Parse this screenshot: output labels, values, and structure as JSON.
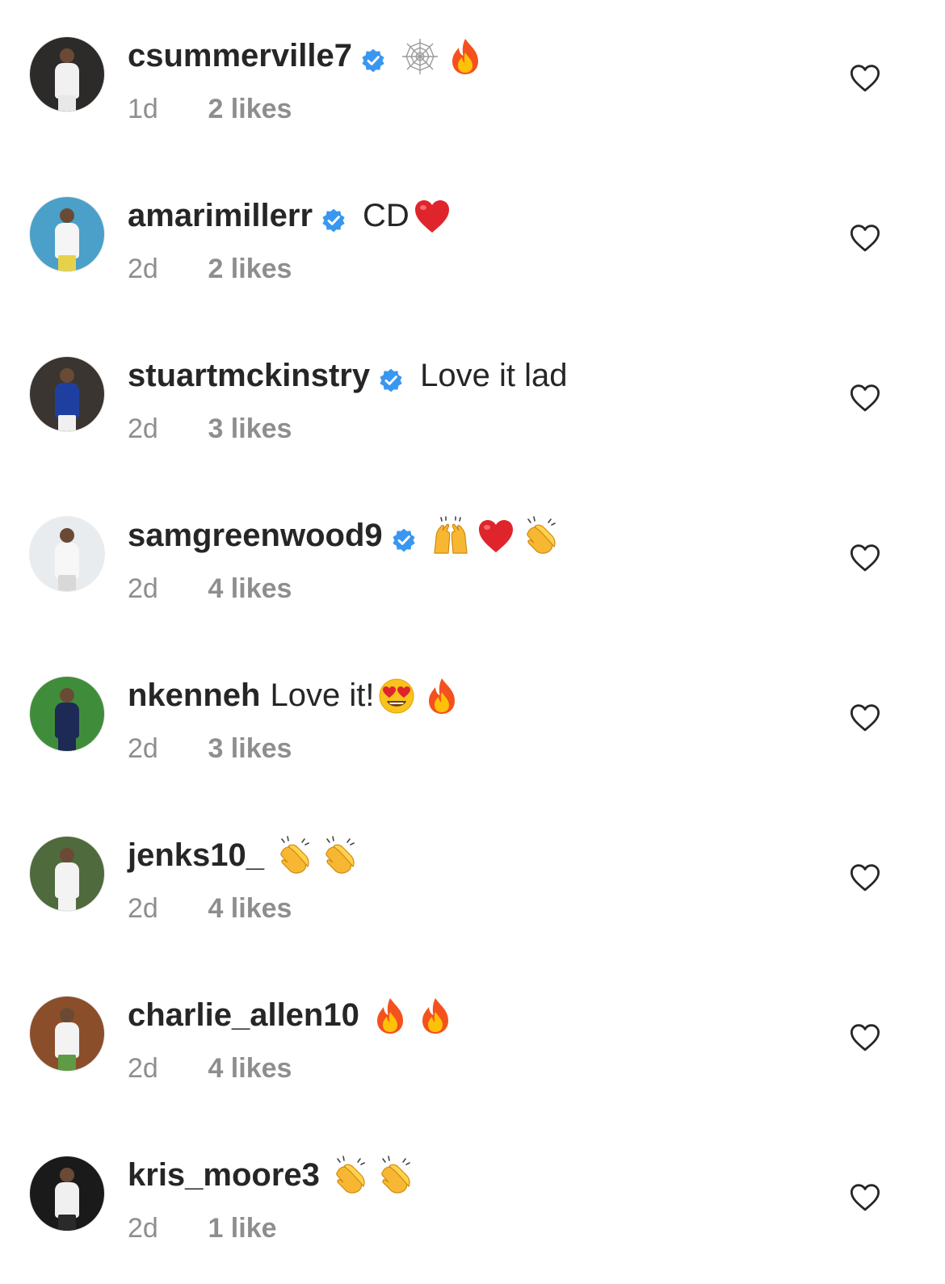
{
  "comments": [
    {
      "username": "csummerville7",
      "verified": true,
      "text": "",
      "emojis": [
        "spider-web",
        "fire"
      ],
      "time": "1d",
      "likes": "2 likes",
      "avatar": {
        "bg": "#2d2a2a",
        "body": "#f1f1f1",
        "legs": "#e8e8e8"
      }
    },
    {
      "username": "amarimillerr",
      "verified": true,
      "text": "CD",
      "emojis": [
        "red-heart"
      ],
      "time": "2d",
      "likes": "2 likes",
      "avatar": {
        "bg": "#4aa0c8",
        "body": "#f5f5f5",
        "legs": "#e6d24a"
      }
    },
    {
      "username": "stuartmckinstry",
      "verified": true,
      "text": "Love it lad",
      "emojis": [],
      "time": "2d",
      "likes": "3 likes",
      "avatar": {
        "bg": "#3a3530",
        "body": "#1f3fa0",
        "legs": "#f0f0f0"
      }
    },
    {
      "username": "samgreenwood9",
      "verified": true,
      "text": "",
      "emojis": [
        "raising-hands",
        "red-heart",
        "clapping-hands"
      ],
      "time": "2d",
      "likes": "4 likes",
      "avatar": {
        "bg": "#e9ecef",
        "body": "#f7f7f7",
        "legs": "#d8d8d8"
      }
    },
    {
      "username": "nkenneh",
      "verified": false,
      "text": "Love it!",
      "emojis": [
        "heart-eyes",
        "fire"
      ],
      "time": "2d",
      "likes": "3 likes",
      "avatar": {
        "bg": "#3f8d3a",
        "body": "#1c2a55",
        "legs": "#1c2a55"
      }
    },
    {
      "username": "jenks10_",
      "verified": false,
      "text": "",
      "emojis": [
        "clapping-hands",
        "clapping-hands"
      ],
      "time": "2d",
      "likes": "4 likes",
      "avatar": {
        "bg": "#4f6a3c",
        "body": "#f3f3f3",
        "legs": "#f3f3f3"
      }
    },
    {
      "username": "charlie_allen10",
      "verified": false,
      "text": "",
      "emojis": [
        "fire",
        "fire"
      ],
      "time": "2d",
      "likes": "4 likes",
      "avatar": {
        "bg": "#8a4f2a",
        "body": "#f3f3f3",
        "legs": "#5f9b44"
      }
    },
    {
      "username": "kris_moore3",
      "verified": false,
      "text": "",
      "emojis": [
        "clapping-hands",
        "clapping-hands"
      ],
      "time": "2d",
      "likes": "1 like",
      "avatar": {
        "bg": "#1a1a1a",
        "body": "#f0f0f0",
        "legs": "#2a2a2a"
      }
    }
  ],
  "colors": {
    "verified": "#3897f0",
    "muted": "#8e8e8e",
    "text": "#262626"
  },
  "icons": {
    "verified": "verified-badge-icon",
    "like": "heart-outline-icon"
  }
}
